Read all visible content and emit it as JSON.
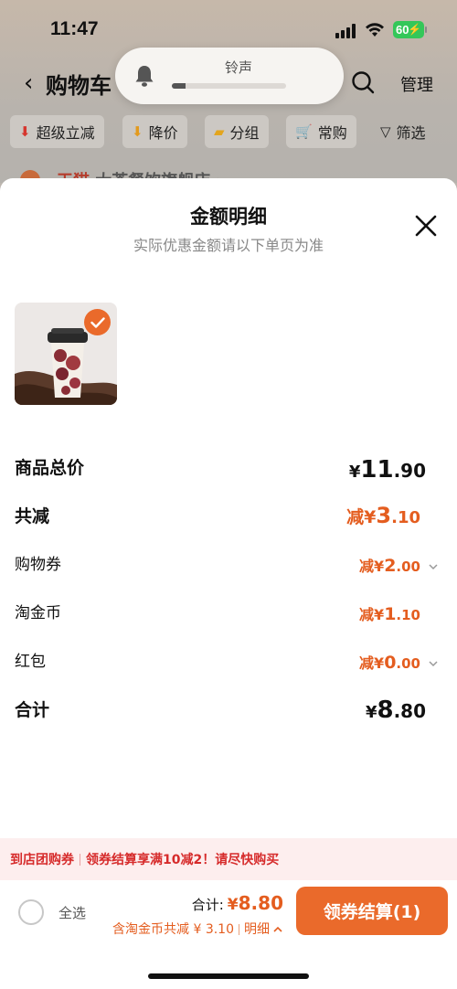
{
  "status_bar": {
    "time": "11:47",
    "battery": "60"
  },
  "nav": {
    "title": "购物车",
    "manage": "管理"
  },
  "filters": [
    {
      "label": "超级立减",
      "icon": "down-arrow-red-icon"
    },
    {
      "label": "降价",
      "icon": "down-arrow-orange-icon"
    },
    {
      "label": "分组",
      "icon": "folder-icon"
    },
    {
      "label": "常购",
      "icon": "cart-icon"
    },
    {
      "label": "筛选",
      "icon": "filter-icon"
    }
  ],
  "peek": {
    "tag": "天猫",
    "text": "大茶餐饮旗舰店 ›"
  },
  "ringer": {
    "label": "铃声",
    "level": 0.12
  },
  "sheet": {
    "title": "金额明细",
    "subtitle": "实际优惠金额请以下单页为准",
    "rows": {
      "total": {
        "label": "商品总价",
        "cur": "¥",
        "int": "11",
        "dec": ".90"
      },
      "reduce": {
        "label": "共减",
        "prefix": "减¥",
        "int": "3",
        "dec": ".10"
      },
      "coupon": {
        "label": "购物券",
        "prefix": "减¥",
        "int": "2",
        "dec": ".00"
      },
      "coins": {
        "label": "淘金币",
        "prefix": "减¥",
        "int": "1",
        "dec": ".10"
      },
      "redpack": {
        "label": "红包",
        "prefix": "减¥",
        "int": "0",
        "dec": ".00"
      },
      "sum": {
        "label": "合计",
        "cur": "¥",
        "int": "8",
        "dec": ".80"
      }
    }
  },
  "promo": {
    "part1": "到店团购券",
    "part2": "领券结算享满10减2！请尽快购买"
  },
  "footer": {
    "select_all": "全选",
    "sum_label": "合计:",
    "sum_cur": "¥",
    "sum_value": "8.80",
    "sub_text": "含淘金币共减 ¥ 3.10",
    "detail": "明细",
    "checkout": "领券结算(1)"
  },
  "colors": {
    "accent": "#ea6a2b",
    "price_orange": "#e45d1f",
    "promo_bg": "#fdeeee",
    "promo_text": "#d62b2b"
  }
}
